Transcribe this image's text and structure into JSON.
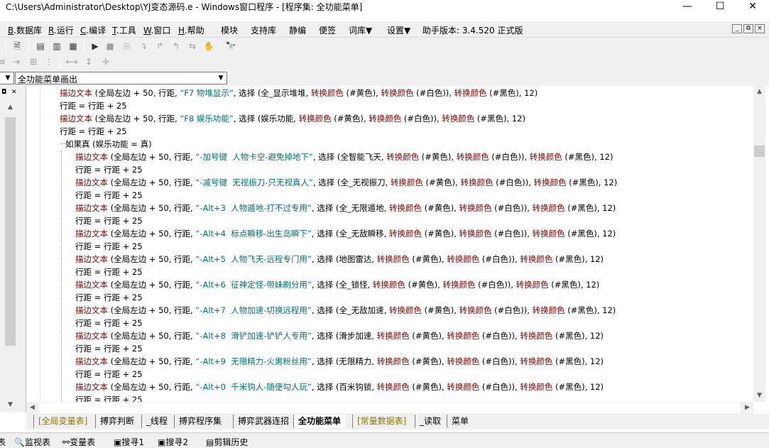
{
  "window": {
    "title": "C:\\Users\\Administrator\\Desktop\\YJ变态源码.e - Windows窗口程序 - [程序集: 全功能菜单]",
    "minimize": "—",
    "maximize": "☐",
    "close": "✕"
  },
  "menu": {
    "items": [
      {
        "key": "B",
        "label": ".数据库"
      },
      {
        "key": "R",
        "label": ".运行"
      },
      {
        "key": "C",
        "label": ".编译"
      },
      {
        "key": "T",
        "label": ".工具"
      },
      {
        "key": "W",
        "label": ".窗口"
      },
      {
        "key": "H",
        "label": ".帮助"
      }
    ],
    "extras": [
      "模块",
      "支持库",
      "静编",
      "便签",
      "词库▼",
      "设置▼"
    ],
    "version": "助手版本: 3.4.520 正式版",
    "mdi": [
      "_",
      "⧉",
      "×"
    ]
  },
  "toolbar": {
    "icons": [
      "save-icon",
      "layout1-icon",
      "layout2-icon",
      "layout3-icon",
      "run-icon",
      "stop-icon",
      "step-icon"
    ]
  },
  "combo": {
    "left": "",
    "main": "全功能菜单画出"
  },
  "code": {
    "lines": [
      {
        "indent": 0,
        "parts": [
          [
            "cmd",
            "描边文本"
          ],
          [
            "n",
            " (全局左边 + 50, 行距, "
          ],
          [
            "str",
            "“F7 物堆显示”"
          ],
          [
            "n",
            ", 选择 (全_显示堆堆, "
          ],
          [
            "cmd",
            "转换颜色"
          ],
          [
            "n",
            " (#黄色), "
          ],
          [
            "cmd",
            "转换颜色"
          ],
          [
            "n",
            " (#白色)), "
          ],
          [
            "cmd",
            "转换颜色"
          ],
          [
            "n",
            " (#黑色), 12)"
          ]
        ]
      },
      {
        "indent": 0,
        "parts": [
          [
            "n",
            "行距 = 行距 + 25"
          ]
        ]
      },
      {
        "indent": 0,
        "parts": [
          [
            "cmd",
            "描边文本"
          ],
          [
            "n",
            " (全局左边 + 50, 行距, "
          ],
          [
            "str",
            "“F8 娱乐功能”"
          ],
          [
            "n",
            ", 选择 (娱乐功能, "
          ],
          [
            "cmd",
            "转换颜色"
          ],
          [
            "n",
            " (#黄色), "
          ],
          [
            "cmd",
            "转换颜色"
          ],
          [
            "n",
            " (#白色)), "
          ],
          [
            "cmd",
            "转换颜色"
          ],
          [
            "n",
            " (#黑色), 12)"
          ]
        ]
      },
      {
        "indent": 0,
        "parts": [
          [
            "n",
            "行距 = 行距 + 25"
          ]
        ]
      },
      {
        "indent": 1,
        "parts": [
          [
            "n",
            "如果真 (娱乐功能 = 真)"
          ]
        ]
      },
      {
        "indent": 2,
        "parts": [
          [
            "cmd",
            "描边文本"
          ],
          [
            "n",
            " (全局左边 + 50, 行距, "
          ],
          [
            "str",
            "“-加号键  人物卡空-避免掉地下”"
          ],
          [
            "n",
            ", 选择 (全智能飞天, "
          ],
          [
            "cmd",
            "转换颜色"
          ],
          [
            "n",
            " (#黄色), "
          ],
          [
            "cmd",
            "转换颜色"
          ],
          [
            "n",
            " (#白色)), "
          ],
          [
            "cmd",
            "转换颜色"
          ],
          [
            "n",
            " (#黑色), 12)"
          ]
        ]
      },
      {
        "indent": 2,
        "parts": [
          [
            "n",
            "行距 = 行距 + 25"
          ]
        ]
      },
      {
        "indent": 2,
        "parts": [
          [
            "cmd",
            "描边文本"
          ],
          [
            "n",
            " (全局左边 + 50, 行距, "
          ],
          [
            "str",
            "“-减号键  无视振刀-只无视真人”"
          ],
          [
            "n",
            ", 选择 (全_无视振刀, "
          ],
          [
            "cmd",
            "转换颜色"
          ],
          [
            "n",
            " (#黄色), "
          ],
          [
            "cmd",
            "转换颜色"
          ],
          [
            "n",
            " (#白色)), "
          ],
          [
            "cmd",
            "转换颜色"
          ],
          [
            "n",
            " (#黑色), 12)"
          ]
        ]
      },
      {
        "indent": 2,
        "parts": [
          [
            "n",
            "行距 = 行距 + 25"
          ]
        ]
      },
      {
        "indent": 2,
        "parts": [
          [
            "cmd",
            "描边文本"
          ],
          [
            "n",
            " (全局左边 + 50, 行距, "
          ],
          [
            "str",
            "“-Alt+3  人物遁地-打不过专用”"
          ],
          [
            "n",
            ", 选择 (全_无限遁地, "
          ],
          [
            "cmd",
            "转换颜色"
          ],
          [
            "n",
            " (#黄色), "
          ],
          [
            "cmd",
            "转换颜色"
          ],
          [
            "n",
            " (#白色)), "
          ],
          [
            "cmd",
            "转换颜色"
          ],
          [
            "n",
            " (#黑色), 12)"
          ]
        ]
      },
      {
        "indent": 2,
        "parts": [
          [
            "n",
            "行距 = 行距 + 25"
          ]
        ]
      },
      {
        "indent": 2,
        "parts": [
          [
            "cmd",
            "描边文本"
          ],
          [
            "n",
            " (全局左边 + 50, 行距, "
          ],
          [
            "str",
            "“-Alt+4  标点瞬移-出生岛瞬下”"
          ],
          [
            "n",
            ", 选择 (全_无敌瞬移, "
          ],
          [
            "cmd",
            "转换颜色"
          ],
          [
            "n",
            " (#黄色), "
          ],
          [
            "cmd",
            "转换颜色"
          ],
          [
            "n",
            " (#白色)), "
          ],
          [
            "cmd",
            "转换颜色"
          ],
          [
            "n",
            " (#黑色), 12)"
          ]
        ]
      },
      {
        "indent": 2,
        "parts": [
          [
            "n",
            "行距 = 行距 + 25"
          ]
        ]
      },
      {
        "indent": 2,
        "parts": [
          [
            "cmd",
            "描边文本"
          ],
          [
            "n",
            " (全局左边 + 50, 行距, "
          ],
          [
            "str",
            "“-Alt+5  人物飞天-远程专门用”"
          ],
          [
            "n",
            ", 选择 (地图雷达, "
          ],
          [
            "cmd",
            "转换颜色"
          ],
          [
            "n",
            " (#黄色), "
          ],
          [
            "cmd",
            "转换颜色"
          ],
          [
            "n",
            " (#白色)), "
          ],
          [
            "cmd",
            "转换颜色"
          ],
          [
            "n",
            " (#黑色), 12)"
          ]
        ]
      },
      {
        "indent": 2,
        "parts": [
          [
            "n",
            "行距 = 行距 + 25"
          ]
        ]
      },
      {
        "indent": 2,
        "parts": [
          [
            "cmd",
            "描边文本"
          ],
          [
            "n",
            " (全局左边 + 50, 行距, "
          ],
          [
            "str",
            "“-Alt+6  征神定怪-带妹刷分用”"
          ],
          [
            "n",
            ", 选择 (全_锁怪, "
          ],
          [
            "cmd",
            "转换颜色"
          ],
          [
            "n",
            " (#黄色), "
          ],
          [
            "cmd",
            "转换颜色"
          ],
          [
            "n",
            " (#白色)), "
          ],
          [
            "cmd",
            "转换颜色"
          ],
          [
            "n",
            " (#黑色), 12)"
          ]
        ]
      },
      {
        "indent": 2,
        "parts": [
          [
            "n",
            "行距 = 行距 + 25"
          ]
        ]
      },
      {
        "indent": 2,
        "parts": [
          [
            "cmd",
            "描边文本"
          ],
          [
            "n",
            " (全局左边 + 50, 行距, "
          ],
          [
            "str",
            "“-Alt+7  人物加速-切换远程用”"
          ],
          [
            "n",
            ", 选择 (全_无敌加速, "
          ],
          [
            "cmd",
            "转换颜色"
          ],
          [
            "n",
            " (#黄色), "
          ],
          [
            "cmd",
            "转换颜色"
          ],
          [
            "n",
            " (#白色)), "
          ],
          [
            "cmd",
            "转换颜色"
          ],
          [
            "n",
            " (#黑色), 12)"
          ]
        ]
      },
      {
        "indent": 2,
        "parts": [
          [
            "n",
            "行距 = 行距 + 25"
          ]
        ]
      },
      {
        "indent": 2,
        "parts": [
          [
            "cmd",
            "描边文本"
          ],
          [
            "n",
            " (全局左边 + 50, 行距, "
          ],
          [
            "str",
            "“-Alt+8  滑铲加速-铲铲人专用”"
          ],
          [
            "n",
            ", 选择 (滑步加速, "
          ],
          [
            "cmd",
            "转换颜色"
          ],
          [
            "n",
            " (#黄色), "
          ],
          [
            "cmd",
            "转换颜色"
          ],
          [
            "n",
            " (#白色)), "
          ],
          [
            "cmd",
            "转换颜色"
          ],
          [
            "n",
            " (#黑色), 12)"
          ]
        ]
      },
      {
        "indent": 2,
        "parts": [
          [
            "n",
            "行距 = 行距 + 25"
          ]
        ]
      },
      {
        "indent": 2,
        "parts": [
          [
            "cmd",
            "描边文本"
          ],
          [
            "n",
            " (全局左边 + 50, 行距, "
          ],
          [
            "str",
            "“-Alt+9  无限精力-火男粉丝用”"
          ],
          [
            "n",
            ", 选择 (无限精力, "
          ],
          [
            "cmd",
            "转换颜色"
          ],
          [
            "n",
            " (#黄色), "
          ],
          [
            "cmd",
            "转换颜色"
          ],
          [
            "n",
            " (#白色)), "
          ],
          [
            "cmd",
            "转换颜色"
          ],
          [
            "n",
            " (#黑色), 12)"
          ]
        ]
      },
      {
        "indent": 2,
        "parts": [
          [
            "n",
            "行距 = 行距 + 25"
          ]
        ]
      },
      {
        "indent": 2,
        "parts": [
          [
            "cmd",
            "描边文本"
          ],
          [
            "n",
            " (全局左边 + 50, 行距, "
          ],
          [
            "str",
            "“-Alt+0  千米钩人-随便勾人玩”"
          ],
          [
            "n",
            ", 选择 (百米钩锁, "
          ],
          [
            "cmd",
            "转换颜色"
          ],
          [
            "n",
            " (#黄色), "
          ],
          [
            "cmd",
            "转换颜色"
          ],
          [
            "n",
            " (#白色)), "
          ],
          [
            "cmd",
            "转换颜色"
          ],
          [
            "n",
            " (#黑色), 12)"
          ]
        ]
      },
      {
        "indent": 2,
        "parts": [
          [
            "n",
            "行距 = 行距 + 25"
          ]
        ]
      }
    ]
  },
  "tabs": [
    {
      "label": "[全局变量表]",
      "style": "green"
    },
    {
      "label": "搏弈判断",
      "style": ""
    },
    {
      "label": "_线程",
      "style": ""
    },
    {
      "label": "搏弈程序集",
      "style": ""
    },
    {
      "label": "搏弈武器连招",
      "style": ""
    },
    {
      "label": "全功能菜单",
      "style": "active"
    },
    {
      "label": "[常量数据表]",
      "style": "green"
    },
    {
      "label": "_读取",
      "style": ""
    },
    {
      "label": "菜单",
      "style": ""
    }
  ],
  "bottom": {
    "items": [
      "表",
      "监视表",
      "变量表",
      "搜寻1",
      "搜寻2",
      "剪辑历史"
    ]
  },
  "colors": {
    "string": "#007070",
    "command": "#800000",
    "background": "#f0f0f0"
  }
}
